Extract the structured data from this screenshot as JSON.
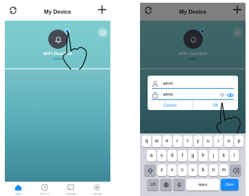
{
  "left": {
    "title": "My Device",
    "device": {
      "name": "WIFI Doorbell",
      "status": "Online"
    },
    "tabs": [
      {
        "label": "Live",
        "icon": "home-icon"
      },
      {
        "label": "Record",
        "icon": "clock-icon"
      },
      {
        "label": "Message",
        "icon": "message-icon"
      },
      {
        "label": "Setting",
        "icon": "gear-icon"
      }
    ]
  },
  "right": {
    "title": "My Device",
    "device": {
      "name": "WIFI Doorbell",
      "status": "Online"
    },
    "dialog": {
      "username": "admin",
      "password": "admin",
      "cancel_label": "Cancel",
      "ok_label": "OK"
    },
    "keyboard": {
      "row1": [
        "q",
        "w",
        "e",
        "r",
        "t",
        "y",
        "u",
        "i",
        "o",
        "p"
      ],
      "row2": [
        "a",
        "s",
        "d",
        "f",
        "g",
        "h",
        "j",
        "k",
        "l"
      ],
      "row3": [
        "z",
        "x",
        "c",
        "v",
        "b",
        "n",
        "m"
      ],
      "numbers_label": "123",
      "space_label": "space",
      "done_label": "Done"
    }
  },
  "colors": {
    "accent": "#1a8cff",
    "teal": "#77c2c8",
    "bell_dark": "#444b52"
  }
}
